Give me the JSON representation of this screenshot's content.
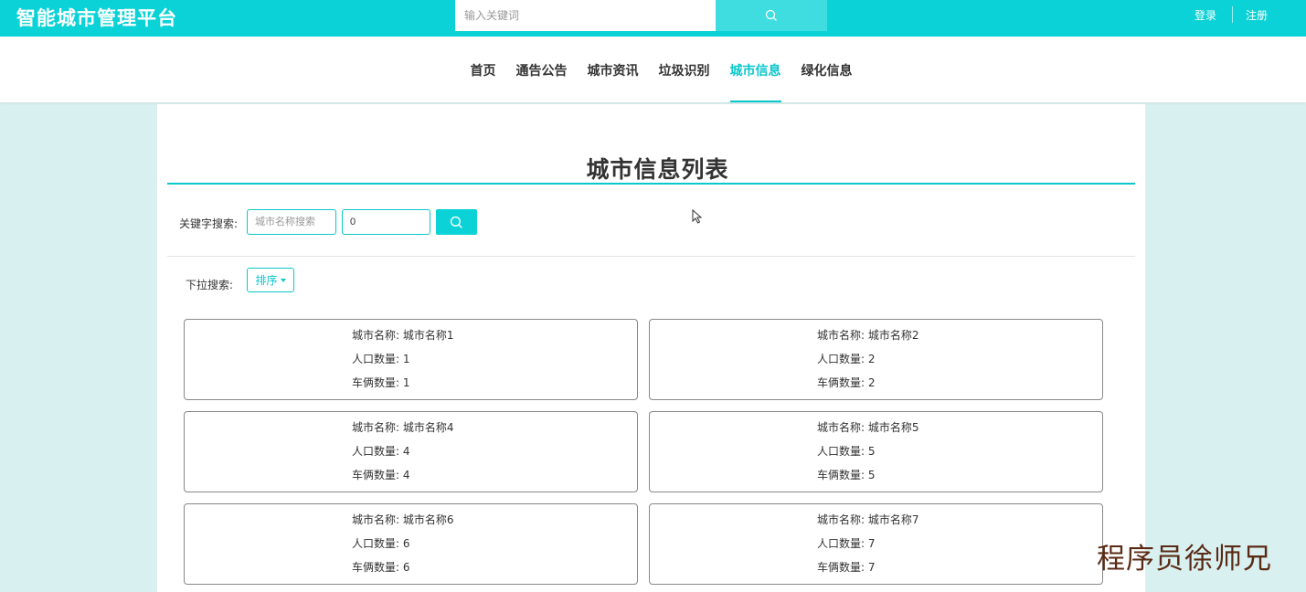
{
  "header": {
    "brand": "智能城市管理平台",
    "search_placeholder": "输入关键词",
    "login": "登录",
    "register": "注册",
    "accent_color": "#0bd2d6"
  },
  "nav": {
    "items": [
      "首页",
      "通告公告",
      "城市资讯",
      "垃圾识别",
      "城市信息",
      "绿化信息"
    ],
    "active": "城市信息"
  },
  "page": {
    "title": "城市信息列表",
    "keyword_label": "关键字搜索:",
    "name_placeholder": "城市名称搜索",
    "number_value": "0",
    "dropdown_label": "下拉搜索:",
    "sort_label": "排序"
  },
  "cards": [
    {
      "name_label": "城市名称:",
      "name": "城市名称1",
      "pop_label": "人口数量:",
      "pop": "1",
      "car_label": "车俩数量:",
      "car": "1"
    },
    {
      "name_label": "城市名称:",
      "name": "城市名称2",
      "pop_label": "人口数量:",
      "pop": "2",
      "car_label": "车俩数量:",
      "car": "2"
    },
    {
      "name_label": "城市名称:",
      "name": "城市名称4",
      "pop_label": "人口数量:",
      "pop": "4",
      "car_label": "车俩数量:",
      "car": "4"
    },
    {
      "name_label": "城市名称:",
      "name": "城市名称5",
      "pop_label": "人口数量:",
      "pop": "5",
      "car_label": "车俩数量:",
      "car": "5"
    },
    {
      "name_label": "城市名称:",
      "name": "城市名称6",
      "pop_label": "人口数量:",
      "pop": "6",
      "car_label": "车俩数量:",
      "car": "6"
    },
    {
      "name_label": "城市名称:",
      "name": "城市名称7",
      "pop_label": "人口数量:",
      "pop": "7",
      "car_label": "车俩数量:",
      "car": "7"
    }
  ],
  "watermark": "程序员徐师兄",
  "icons": {
    "search": "search-icon",
    "sort_caret": "caret-down-icon",
    "cursor": "mouse-cursor-icon"
  }
}
